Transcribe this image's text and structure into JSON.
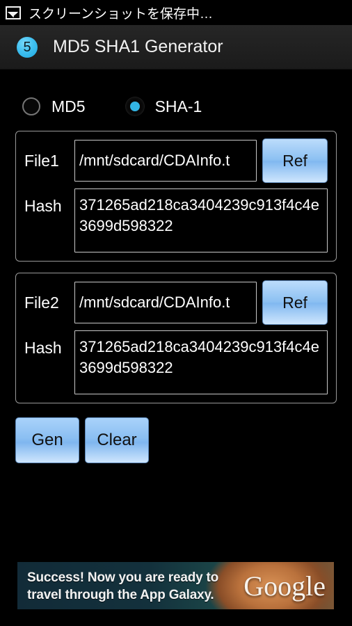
{
  "status_bar": {
    "icon": "image-icon",
    "text": "スクリーンショットを保存中…"
  },
  "action_bar": {
    "icon": "app-badge-5-icon",
    "icon_label": "5",
    "title": "MD5 SHA1 Generator",
    "accent_color": "#33b5e5"
  },
  "algorithm": {
    "options": [
      {
        "label": "MD5",
        "selected": false
      },
      {
        "label": "SHA-1",
        "selected": true
      }
    ]
  },
  "file1": {
    "label": "File1",
    "path": "/mnt/sdcard/CDAInfo.t",
    "path_placeholder": "",
    "ref_label": "Ref",
    "hash_label": "Hash",
    "hash": "371265ad218ca3404239c913f4c4e3699d598322"
  },
  "file2": {
    "label": "File2",
    "path": "/mnt/sdcard/CDAInfo.t",
    "path_placeholder": "",
    "ref_label": "Ref",
    "hash_label": "Hash",
    "hash": "371265ad218ca3404239c913f4c4e3699d598322"
  },
  "actions": {
    "gen_label": "Gen",
    "clear_label": "Clear"
  },
  "ad": {
    "line1": "Success! Now you are ready to",
    "line2": "travel through the App Galaxy.",
    "brand": "Google"
  }
}
